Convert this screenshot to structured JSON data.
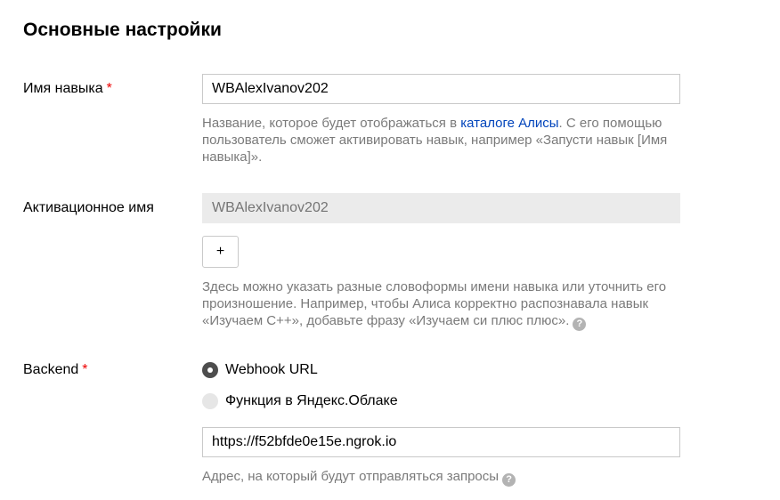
{
  "section": {
    "title": "Основные настройки"
  },
  "skill_name": {
    "label": "Имя навыка",
    "required_mark": "*",
    "value": "WBAlexIvanov202",
    "hint_before_link": "Название, которое будет отображаться в ",
    "hint_link": "каталоге Алисы",
    "hint_after_link": ". С его помощью пользователь сможет активировать навык, например «Запусти навык [Имя навыка]»."
  },
  "activation_name": {
    "label": "Активационное имя",
    "placeholder": "WBAlexIvanov202",
    "add_button_label": "+",
    "hint": "Здесь можно указать разные словоформы имени навыка или уточнить его произношение. Например, чтобы Алиса корректно распознавала навык «Изучаем C++», добавьте фразу «Изучаем си плюс плюс».",
    "help_icon": "question-circle-icon"
  },
  "backend": {
    "label": "Backend",
    "required_mark": "*",
    "options": [
      {
        "label": "Webhook URL",
        "selected": true
      },
      {
        "label": "Функция в Яндекс.Облаке",
        "selected": false
      }
    ],
    "url_value": "https://f52bfde0e15e.ngrok.io",
    "hint": "Адрес, на который будут отправляться запросы",
    "help_icon": "question-circle-icon"
  }
}
